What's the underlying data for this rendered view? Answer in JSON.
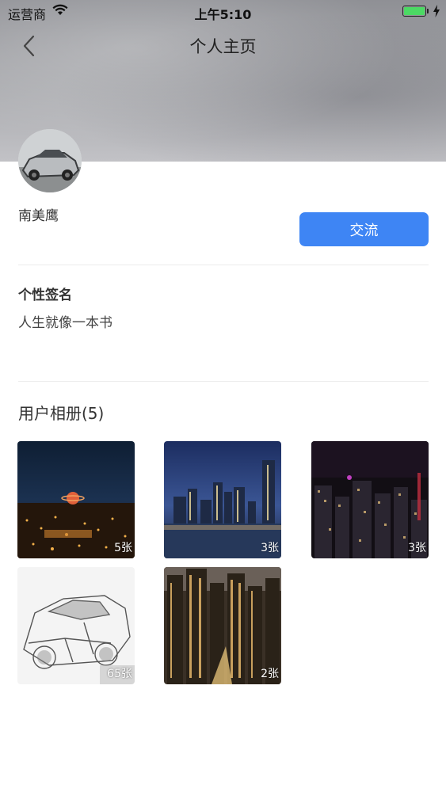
{
  "status_bar": {
    "carrier": "运营商",
    "time": "上午5:10"
  },
  "nav": {
    "title": "个人主页",
    "back_icon": "chevron-left-icon"
  },
  "profile": {
    "name": "南美鹰",
    "chat_button_label": "交流"
  },
  "signature": {
    "heading": "个性签名",
    "text": "人生就像一本书"
  },
  "album": {
    "heading": "用户相册(5)",
    "photos": [
      {
        "count_label": "5张"
      },
      {
        "count_label": "3张"
      },
      {
        "count_label": "3张"
      },
      {
        "count_label": "65张"
      },
      {
        "count_label": "2张"
      }
    ]
  },
  "colors": {
    "accent": "#3e85f4",
    "battery": "#4cd964"
  }
}
